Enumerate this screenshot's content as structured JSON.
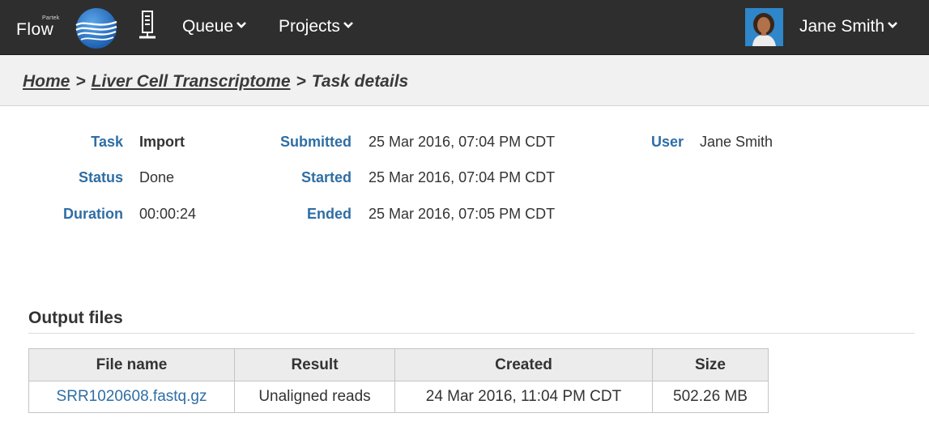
{
  "header": {
    "logo": {
      "small_text": "Partek",
      "text": "Flow"
    },
    "menu": [
      {
        "label": "Queue"
      },
      {
        "label": "Projects"
      }
    ],
    "user_name": "Jane Smith"
  },
  "breadcrumb": {
    "items": [
      {
        "label": "Home"
      },
      {
        "label": "Liver Cell Transcriptome"
      }
    ],
    "separator": ">",
    "current": "Task details"
  },
  "task": {
    "task": {
      "label": "Task",
      "value": "Import"
    },
    "status": {
      "label": "Status",
      "value": "Done"
    },
    "duration": {
      "label": "Duration",
      "value": "00:00:24"
    },
    "submitted": {
      "label": "Submitted",
      "value": "25 Mar 2016, 07:04 PM CDT"
    },
    "started": {
      "label": "Started",
      "value": "25 Mar 2016, 07:04 PM CDT"
    },
    "ended": {
      "label": "Ended",
      "value": "25 Mar 2016, 07:05 PM CDT"
    },
    "user": {
      "label": "User",
      "value": "Jane Smith"
    }
  },
  "output_files": {
    "title": "Output files",
    "columns": [
      "File name",
      "Result",
      "Created",
      "Size"
    ],
    "rows": [
      [
        "SRR1020608.fastq.gz",
        "Unaligned reads",
        "24 Mar 2016, 11:04 PM CDT",
        "502.26 MB"
      ]
    ]
  },
  "colors": {
    "topbar": "#2e2e2e",
    "label_blue": "#2f6ea5",
    "crumb_background": "#f1f1f1",
    "table_header": "#ececec"
  },
  "icons": [
    "flow-globe-icon",
    "server-icon",
    "chevron-down-icon",
    "user-avatar-icon"
  ]
}
